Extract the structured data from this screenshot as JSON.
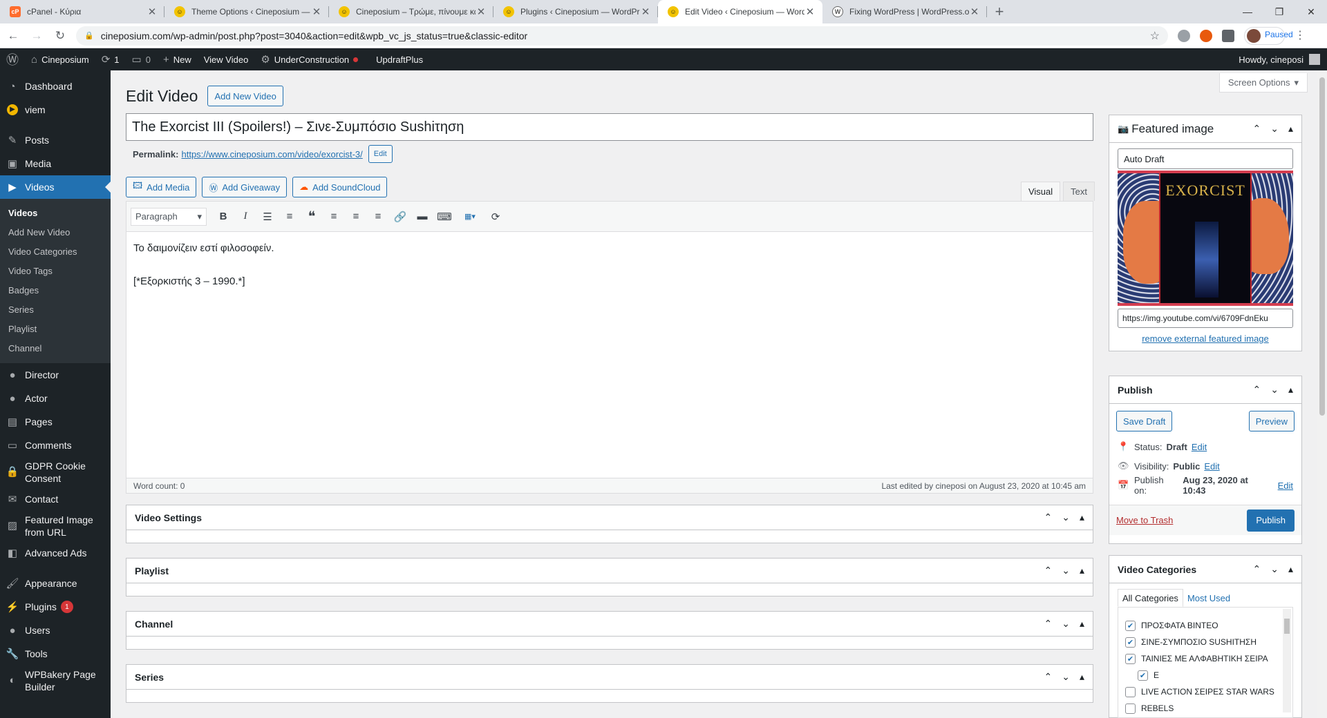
{
  "browser": {
    "tabs": [
      {
        "title": "cPanel - Κύρια",
        "favicon": "cpanel-icon"
      },
      {
        "title": "Theme Options ‹ Cineposium —",
        "favicon": "cineposium-icon"
      },
      {
        "title": "Cineposium – Τρώμε, πίνουμε κα",
        "favicon": "cineposium-icon"
      },
      {
        "title": "Plugins ‹ Cineposium — WordPre",
        "favicon": "cineposium-icon"
      },
      {
        "title": "Edit Video ‹ Cineposium — Word",
        "favicon": "cineposium-icon",
        "active": true
      },
      {
        "title": "Fixing WordPress | WordPress.org",
        "favicon": "wordpress-icon"
      }
    ],
    "url": "cineposium.com/wp-admin/post.php?post=3040&action=edit&wpb_vc_js_status=true&classic-editor",
    "profile_label": "Paused"
  },
  "adminbar": {
    "site": "Cineposium",
    "updates": "1",
    "comments": "0",
    "new_label": "New",
    "view_label": "View Video",
    "under_construction": "UnderConstruction",
    "updraft": "UpdraftPlus",
    "howdy": "Howdy, cineposi"
  },
  "sidebar": {
    "items_top": [
      {
        "label": "Dashboard",
        "icon": "dashboard-icon"
      },
      {
        "label": "viem",
        "icon": "viem-icon"
      }
    ],
    "items_mid": [
      {
        "label": "Posts",
        "icon": "pin-icon"
      },
      {
        "label": "Media",
        "icon": "media-icon"
      }
    ],
    "current": {
      "label": "Videos",
      "icon": "video-icon"
    },
    "submenu": [
      "Videos",
      "Add New Video",
      "Video Categories",
      "Video Tags",
      "Badges",
      "Series",
      "Playlist",
      "Channel"
    ],
    "items_after": [
      {
        "label": "Director",
        "icon": "user-icon"
      },
      {
        "label": "Actor",
        "icon": "user-icon"
      },
      {
        "label": "Pages",
        "icon": "pages-icon"
      },
      {
        "label": "Comments",
        "icon": "comments-icon"
      },
      {
        "label": "GDPR Cookie Consent",
        "icon": "lock-icon"
      },
      {
        "label": "Contact",
        "icon": "mail-icon"
      },
      {
        "label": "Featured Image from URL",
        "icon": "image-icon"
      },
      {
        "label": "Advanced Ads",
        "icon": "ads-icon"
      },
      {
        "label": "Appearance",
        "icon": "brush-icon"
      },
      {
        "label": "Plugins",
        "icon": "plugin-icon",
        "badge": "1"
      },
      {
        "label": "Users",
        "icon": "users-icon"
      },
      {
        "label": "Tools",
        "icon": "tools-icon"
      },
      {
        "label": "WPBakery Page Builder",
        "icon": "wpbakery-icon"
      }
    ]
  },
  "main": {
    "screen_options": "Screen Options",
    "heading": "Edit Video",
    "add_new": "Add New Video",
    "post_title": "The Exorcist III (Spoilers!) – Σινε-Συμπόσιο Sushiτηση",
    "permalink_label": "Permalink:",
    "permalink_url": "https://www.cineposium.com/video/exorcist-3/",
    "permalink_edit": "Edit",
    "media_buttons": [
      "Add Media",
      "Add Giveaway",
      "Add SoundCloud"
    ],
    "editor_tabs": [
      "Visual",
      "Text"
    ],
    "format_select": "Paragraph",
    "content_lines": [
      "Το δαιμονίζειν εστί φιλοσοφείν.",
      "[*Εξορκιστής 3 – 1990.*]"
    ],
    "word_count": "Word count: 0",
    "last_edited": "Last edited by cineposi on August 23, 2020 at 10:45 am",
    "boxes": [
      "Video Settings",
      "Playlist",
      "Channel",
      "Series"
    ]
  },
  "featured": {
    "title": "Featured image",
    "input_value": "Auto Draft",
    "poster_title": "EXORCIST",
    "url": "https://img.youtube.com/vi/6709FdnEku",
    "remove": "remove external featured image"
  },
  "publish": {
    "title": "Publish",
    "save_draft": "Save Draft",
    "preview": "Preview",
    "status_label": "Status:",
    "status_value": "Draft",
    "visibility_label": "Visibility:",
    "visibility_value": "Public",
    "publish_on_label": "Publish on:",
    "publish_on_value": "Aug 23, 2020 at 10:43",
    "edit": "Edit",
    "trash": "Move to Trash",
    "publish_btn": "Publish"
  },
  "categories": {
    "title": "Video Categories",
    "tabs": [
      "All Categories",
      "Most Used"
    ],
    "items": [
      {
        "label": "ΠΡΟΣΦΑΤΑ ΒΙΝΤΕΟ",
        "checked": true,
        "child": false
      },
      {
        "label": "ΣΙΝΕ-ΣΥΜΠΟΣΙΟ SUSHIΤΗΣΗ",
        "checked": true,
        "child": false
      },
      {
        "label": "ΤΑΙΝΙΕΣ ΜΕ ΑΛΦΑΒΗΤΙΚΗ ΣΕΙΡΑ",
        "checked": true,
        "child": false
      },
      {
        "label": "E",
        "checked": true,
        "child": true
      },
      {
        "label": "LIVE ACTION ΣΕΙΡΕΣ STAR WARS",
        "checked": false,
        "child": false
      },
      {
        "label": "REBELS",
        "checked": false,
        "child": false
      }
    ]
  }
}
